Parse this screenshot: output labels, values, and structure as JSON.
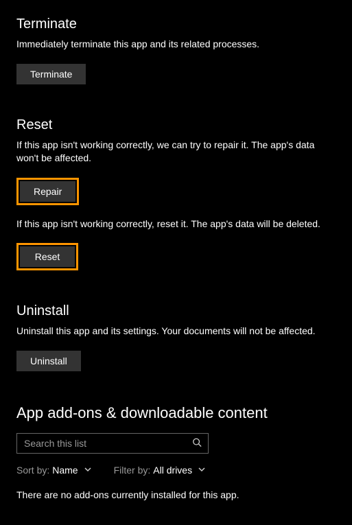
{
  "terminate": {
    "title": "Terminate",
    "description": "Immediately terminate this app and its related processes.",
    "button_label": "Terminate"
  },
  "reset": {
    "title": "Reset",
    "repair_description": "If this app isn't working correctly, we can try to repair it. The app's data won't be affected.",
    "repair_button_label": "Repair",
    "reset_description": "If this app isn't working correctly, reset it. The app's data will be deleted.",
    "reset_button_label": "Reset"
  },
  "uninstall": {
    "title": "Uninstall",
    "description": "Uninstall this app and its settings. Your documents will not be affected.",
    "button_label": "Uninstall"
  },
  "addons": {
    "title": "App add-ons & downloadable content",
    "search_placeholder": "Search this list",
    "sort_label": "Sort by:",
    "sort_value": "Name",
    "filter_label": "Filter by:",
    "filter_value": "All drives",
    "empty_text": "There are no add-ons currently installed for this app."
  }
}
